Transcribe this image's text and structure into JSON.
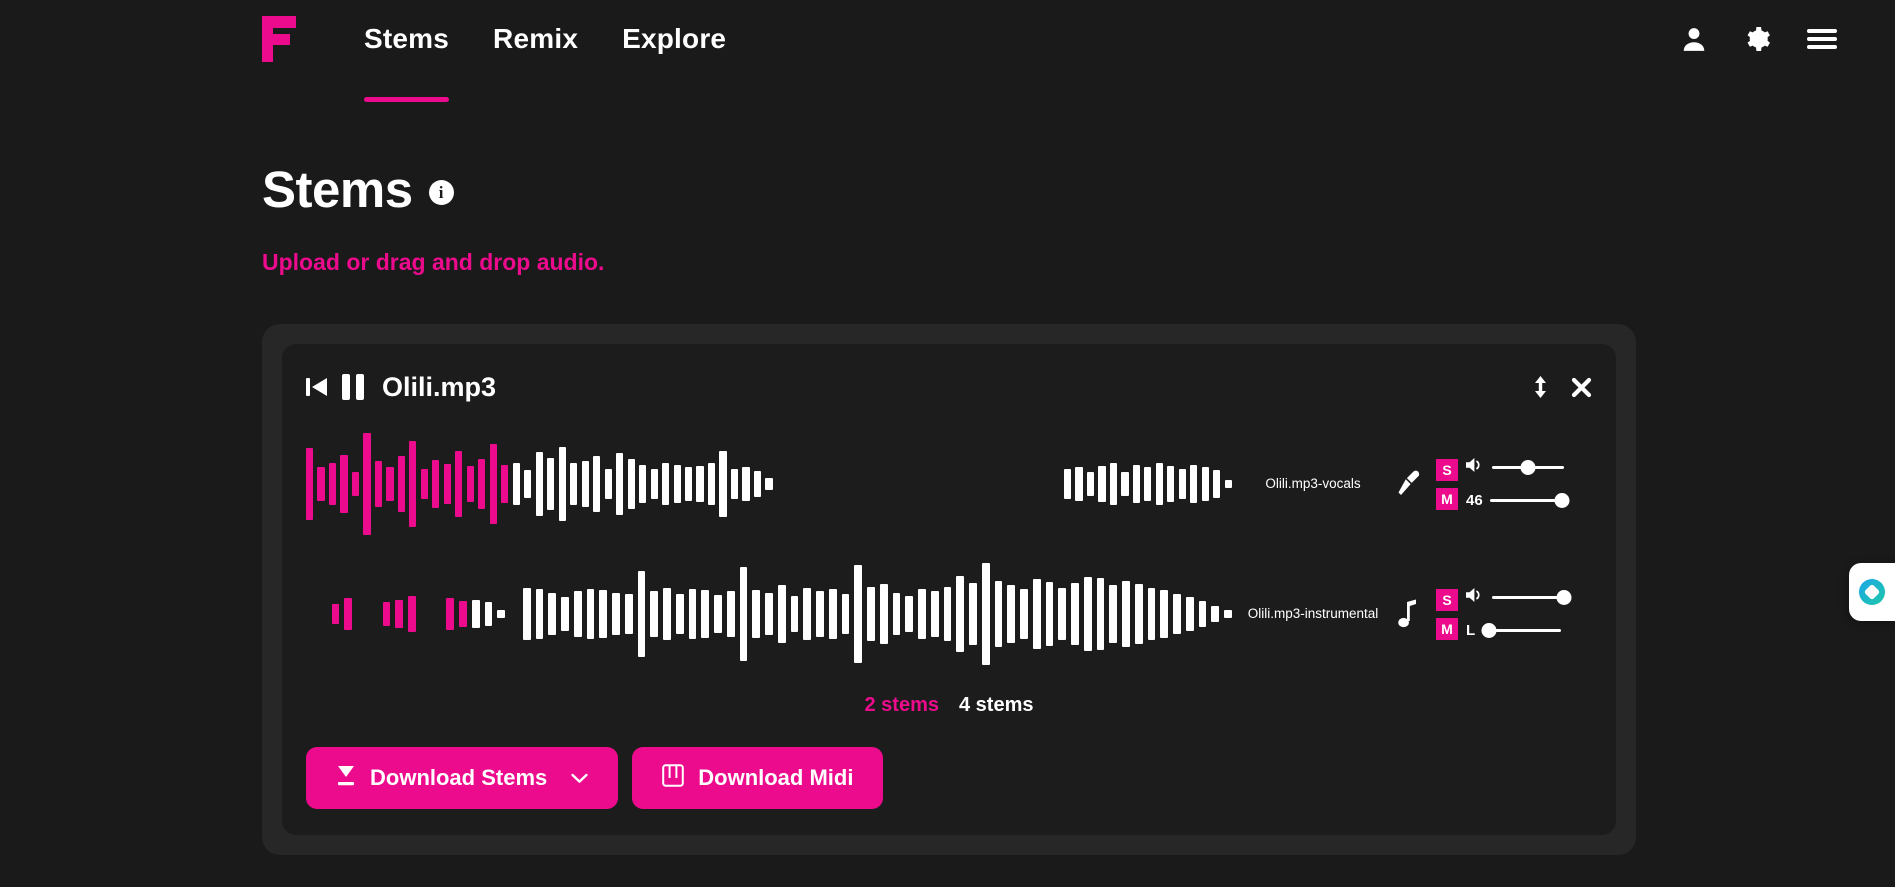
{
  "header": {
    "logo_name": "fadr-logo",
    "nav": [
      {
        "label": "Stems",
        "active": true
      },
      {
        "label": "Remix",
        "active": false
      },
      {
        "label": "Explore",
        "active": false
      }
    ],
    "icons": [
      {
        "name": "user-icon"
      },
      {
        "name": "gear-icon"
      },
      {
        "name": "hamburger-menu-icon"
      }
    ]
  },
  "page": {
    "title": "Stems",
    "info_glyph": "i",
    "subtitle": "Upload or drag and drop audio."
  },
  "player": {
    "prev_icon": "skip-back-icon",
    "pause_icon": "pause-icon",
    "file_name": "Olili.mp3",
    "expand_icon": "expand-vertical-icon",
    "close_icon": "close-icon",
    "stems": [
      {
        "name": "Olili.mp3-vocals",
        "type_icon": "microphone-icon",
        "solo_label": "S",
        "mute_label": "M",
        "volume_icon": "speaker-icon",
        "volume_percent": 50,
        "pan_label": "46",
        "pan_percent": 100,
        "progress_percent": 9.2,
        "waveform": [
          52,
          24,
          30,
          42,
          18,
          74,
          33,
          25,
          40,
          62,
          21,
          34,
          29,
          48,
          26,
          36,
          58,
          27,
          30,
          20,
          46,
          38,
          54,
          31,
          33,
          40,
          22,
          45,
          36,
          28,
          21,
          31,
          27,
          24,
          26,
          30,
          47,
          22,
          24,
          19,
          8,
          0,
          0,
          0,
          0,
          0,
          0,
          0,
          0,
          0,
          0,
          0,
          0,
          0,
          0,
          0,
          0,
          0,
          0,
          0,
          0,
          0,
          0,
          0,
          0,
          0,
          22,
          24,
          18,
          26,
          30,
          18,
          28,
          24,
          30,
          26,
          22,
          28,
          24,
          20,
          6
        ]
      },
      {
        "name": "Olili.mp3-instrumental",
        "type_icon": "music-note-icon",
        "solo_label": "S",
        "mute_label": "M",
        "volume_icon": "speaker-icon",
        "volume_percent": 100,
        "pan_label": "L",
        "pan_percent": 0,
        "progress_percent": 7.4,
        "waveform": [
          0,
          0,
          16,
          26,
          0,
          0,
          20,
          24,
          30,
          0,
          0,
          26,
          22,
          24,
          20,
          6,
          0,
          44,
          42,
          36,
          28,
          38,
          42,
          40,
          36,
          34,
          72,
          38,
          44,
          34,
          42,
          40,
          32,
          38,
          78,
          40,
          36,
          48,
          30,
          44,
          38,
          42,
          34,
          82,
          46,
          50,
          36,
          30,
          42,
          38,
          46,
          64,
          52,
          86,
          56,
          48,
          42,
          58,
          54,
          44,
          52,
          62,
          60,
          48,
          56,
          50,
          44,
          40,
          34,
          28,
          22,
          14,
          6
        ]
      }
    ],
    "stem_count_options": [
      {
        "label": "2 stems",
        "active": true
      },
      {
        "label": "4 stems",
        "active": false
      }
    ],
    "buttons": [
      {
        "label": "Download Stems",
        "icon": "download-icon",
        "chevron": true,
        "name": "download-stems-button"
      },
      {
        "label": "Download Midi",
        "icon": "piano-icon",
        "chevron": false,
        "name": "download-midi-button"
      }
    ]
  },
  "chat_widget": {
    "name": "assistant-widget"
  },
  "colors": {
    "accent": "#ec0b8c",
    "page_bg": "#1a1a1a",
    "outer_card": "#272727",
    "inner_card": "#1c1c1c",
    "text": "#ffffff"
  }
}
